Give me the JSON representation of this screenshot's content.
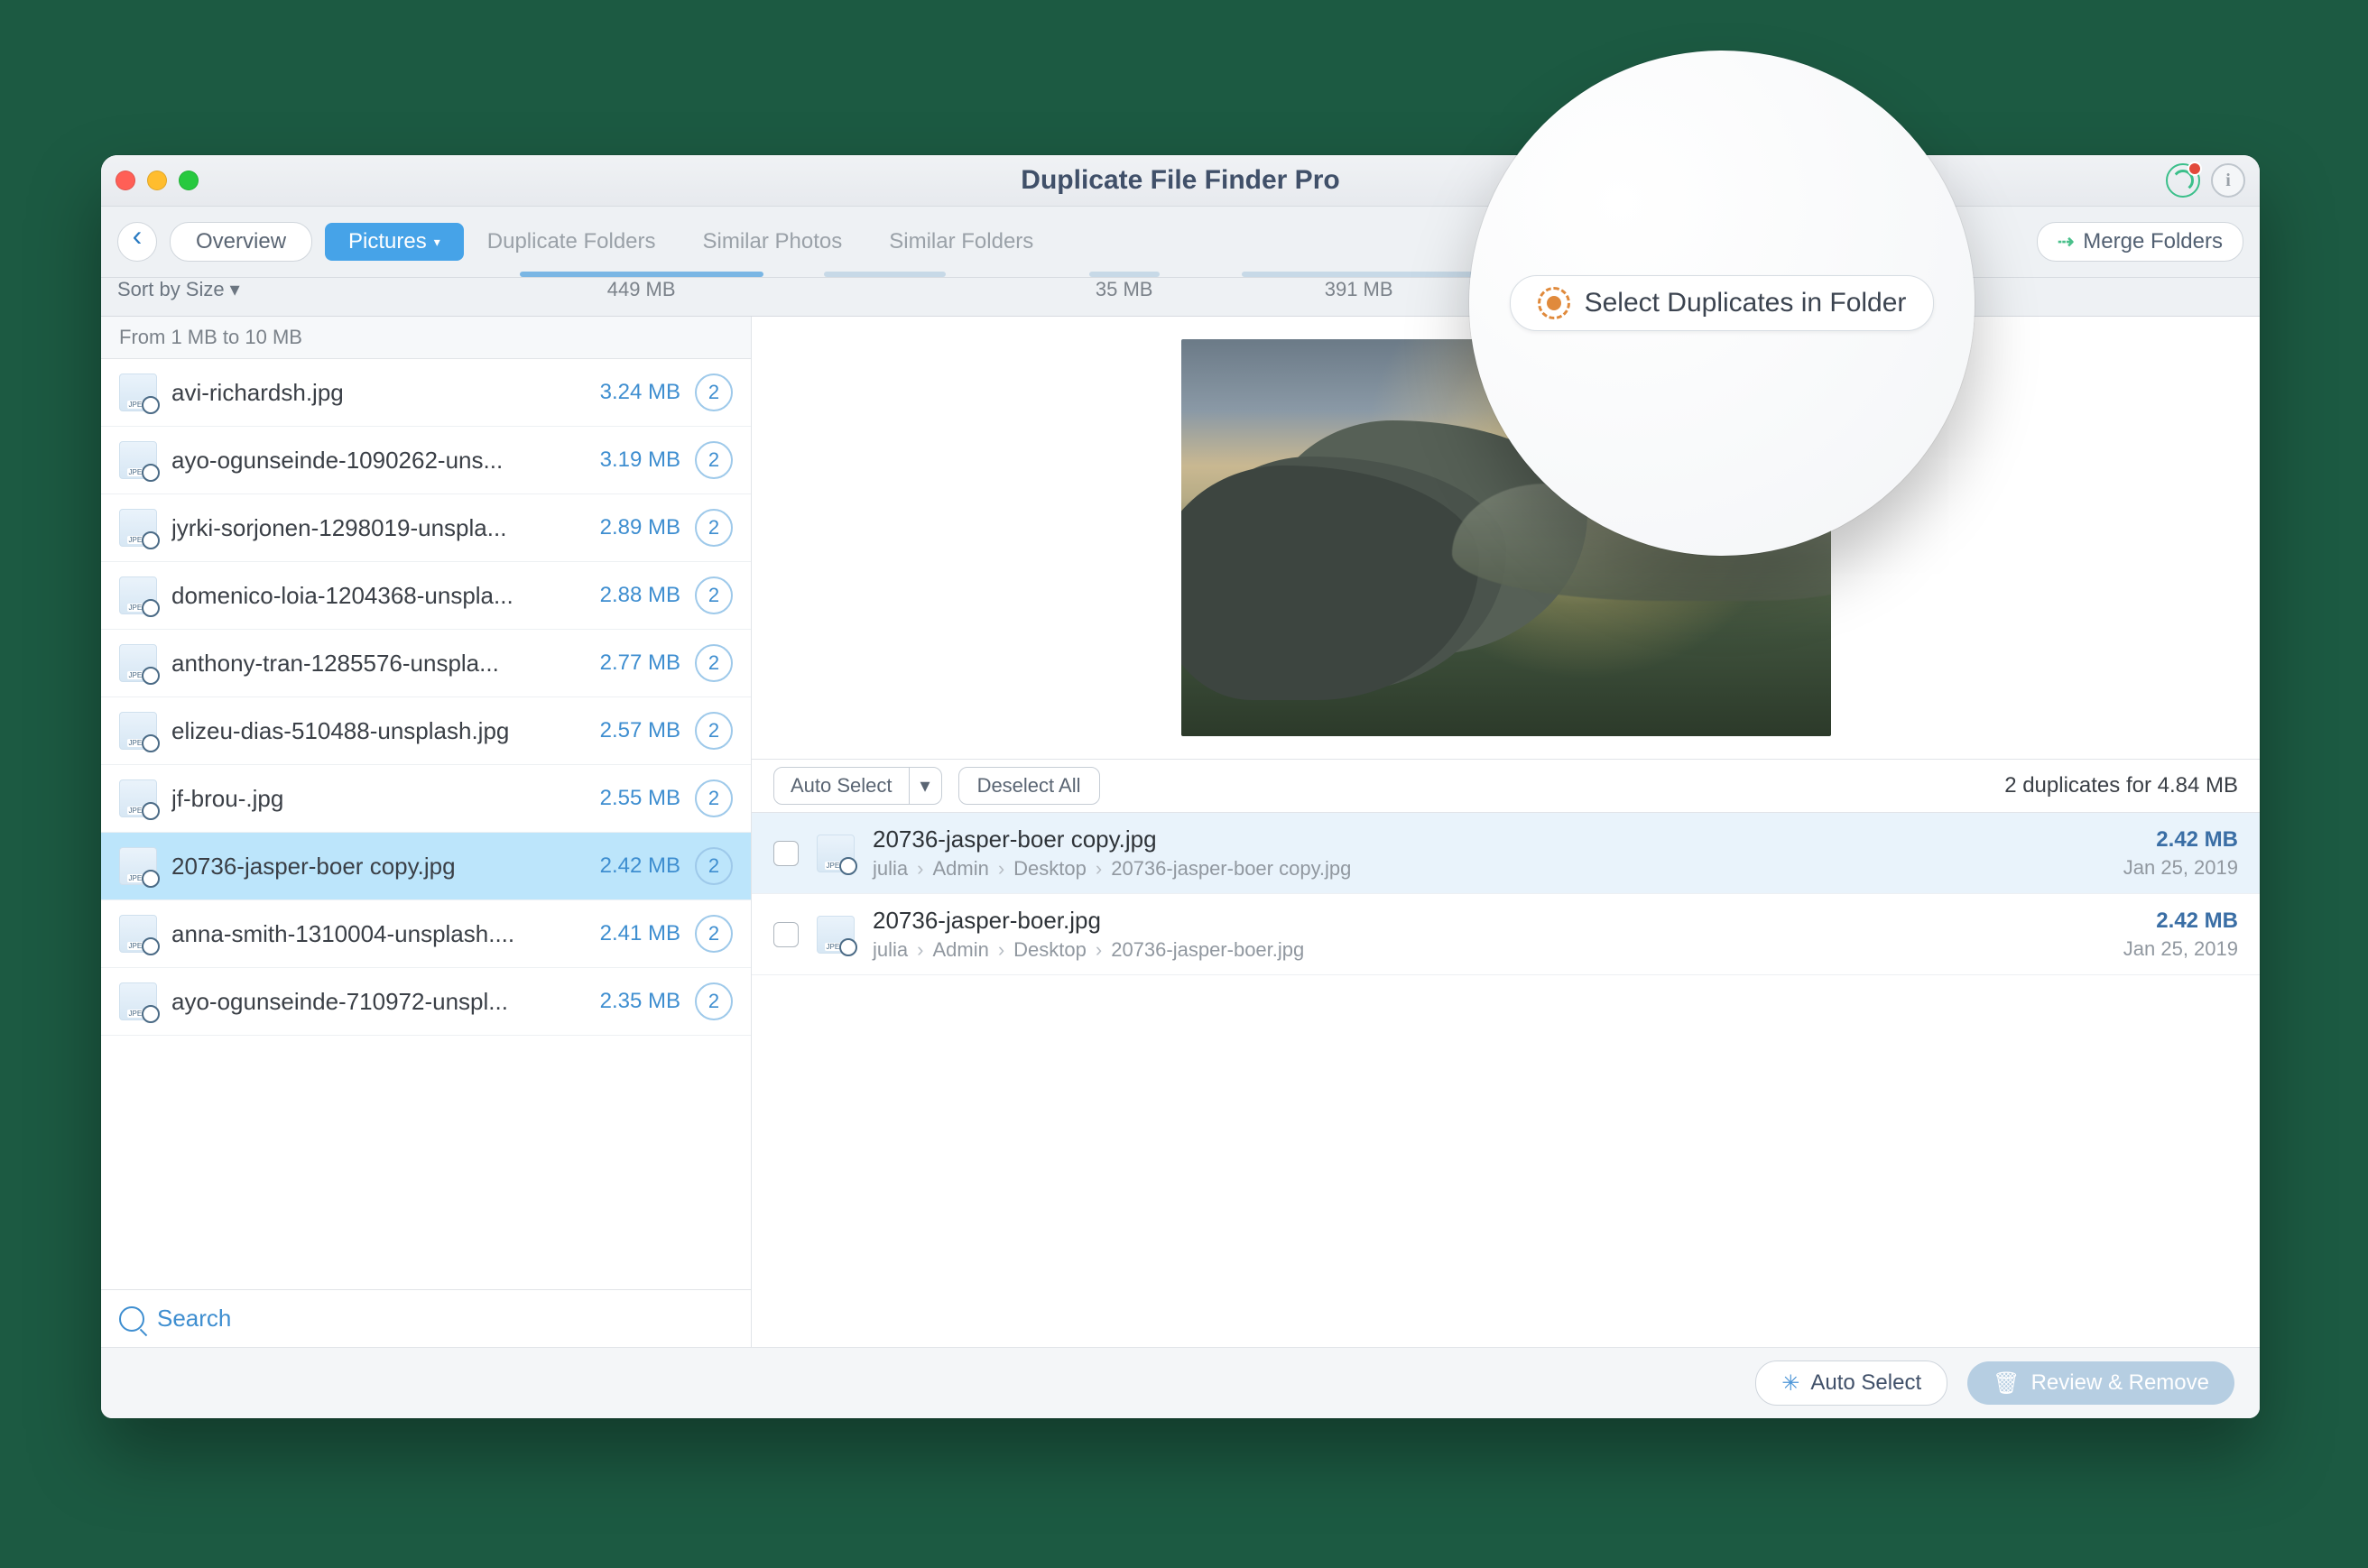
{
  "titlebar": {
    "app_title": "Duplicate File Finder Pro"
  },
  "toolbar": {
    "overview": "Overview",
    "tabs": [
      {
        "label": "Pictures",
        "active": true,
        "size": "449 MB"
      },
      {
        "label": "Duplicate Folders",
        "size": ""
      },
      {
        "label": "Similar Photos",
        "size": "35 MB"
      },
      {
        "label": "Similar Folders",
        "size": "391 MB"
      }
    ],
    "select_duplicates": "Select Duplicates in Folder",
    "merge_folders": "Merge Folders",
    "sort_by": "Sort by Size"
  },
  "sidebar": {
    "group_header": "From 1 MB to 10 MB",
    "files": [
      {
        "name": "avi-richardsh.jpg",
        "size": "3.24 MB",
        "count": "2",
        "selected": false
      },
      {
        "name": "ayo-ogunseinde-1090262-uns...",
        "size": "3.19 MB",
        "count": "2",
        "selected": false
      },
      {
        "name": "jyrki-sorjonen-1298019-unspla...",
        "size": "2.89 MB",
        "count": "2",
        "selected": false
      },
      {
        "name": "domenico-loia-1204368-unspla...",
        "size": "2.88 MB",
        "count": "2",
        "selected": false
      },
      {
        "name": "anthony-tran-1285576-unspla...",
        "size": "2.77 MB",
        "count": "2",
        "selected": false
      },
      {
        "name": "elizeu-dias-510488-unsplash.jpg",
        "size": "2.57 MB",
        "count": "2",
        "selected": false
      },
      {
        "name": "jf-brou-.jpg",
        "size": "2.55 MB",
        "count": "2",
        "selected": false
      },
      {
        "name": "20736-jasper-boer copy.jpg",
        "size": "2.42 MB",
        "count": "2",
        "selected": true
      },
      {
        "name": "anna-smith-1310004-unsplash....",
        "size": "2.41 MB",
        "count": "2",
        "selected": false
      },
      {
        "name": "ayo-ogunseinde-710972-unspl...",
        "size": "2.35 MB",
        "count": "2",
        "selected": false
      }
    ],
    "search_placeholder": "Search"
  },
  "detail": {
    "auto_select": "Auto Select",
    "deselect_all": "Deselect All",
    "summary": "2 duplicates for 4.84 MB",
    "duplicates": [
      {
        "title": "20736-jasper-boer copy.jpg",
        "path": [
          "julia",
          "Admin",
          "Desktop",
          "20736-jasper-boer copy.jpg"
        ],
        "size": "2.42 MB",
        "date": "Jan 25, 2019",
        "alt": true
      },
      {
        "title": "20736-jasper-boer.jpg",
        "path": [
          "julia",
          "Admin",
          "Desktop",
          "20736-jasper-boer.jpg"
        ],
        "size": "2.42 MB",
        "date": "Jan 25, 2019",
        "alt": false
      }
    ]
  },
  "footer": {
    "auto_select": "Auto Select",
    "review": "Review & Remove"
  },
  "lens": {
    "label": "Select Duplicates in Folder"
  }
}
